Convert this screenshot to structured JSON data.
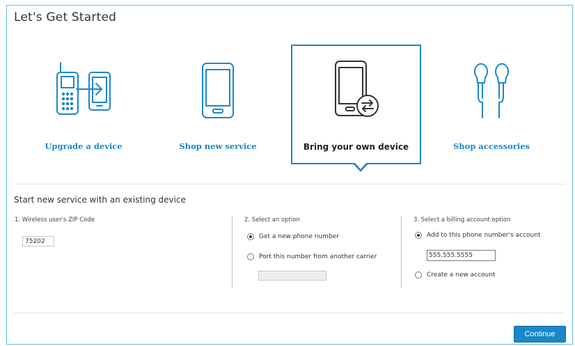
{
  "page": {
    "title": "Let's Get Started"
  },
  "options": [
    {
      "label": "Upgrade a device",
      "icon": "upgrade-device-icon",
      "selected": false
    },
    {
      "label": "Shop new service",
      "icon": "smartphone-icon",
      "selected": false
    },
    {
      "label": "Bring your own device",
      "icon": "phone-transfer-icon",
      "selected": true
    },
    {
      "label": "Shop accessories",
      "icon": "earbuds-icon",
      "selected": false
    }
  ],
  "section": {
    "title": "Start new service with an existing device",
    "zip": {
      "heading": "1. Wireless user's ZIP Code",
      "value": "75202"
    },
    "option": {
      "heading": "2. Select an option",
      "choices": [
        {
          "label": "Get a new phone number",
          "checked": true
        },
        {
          "label": "Port this number from another carrier",
          "checked": false
        }
      ],
      "port_input_value": ""
    },
    "billing": {
      "heading": "3. Select a billing account option",
      "choices": [
        {
          "label": "Add to this phone number's account",
          "checked": true
        },
        {
          "label": "Create a new account",
          "checked": false
        }
      ],
      "phone_value": "555.555.5555"
    }
  },
  "actions": {
    "continue_label": "Continue"
  },
  "colors": {
    "accent": "#1a87c9",
    "frame_border": "#5bc0e6",
    "text": "#333333"
  }
}
